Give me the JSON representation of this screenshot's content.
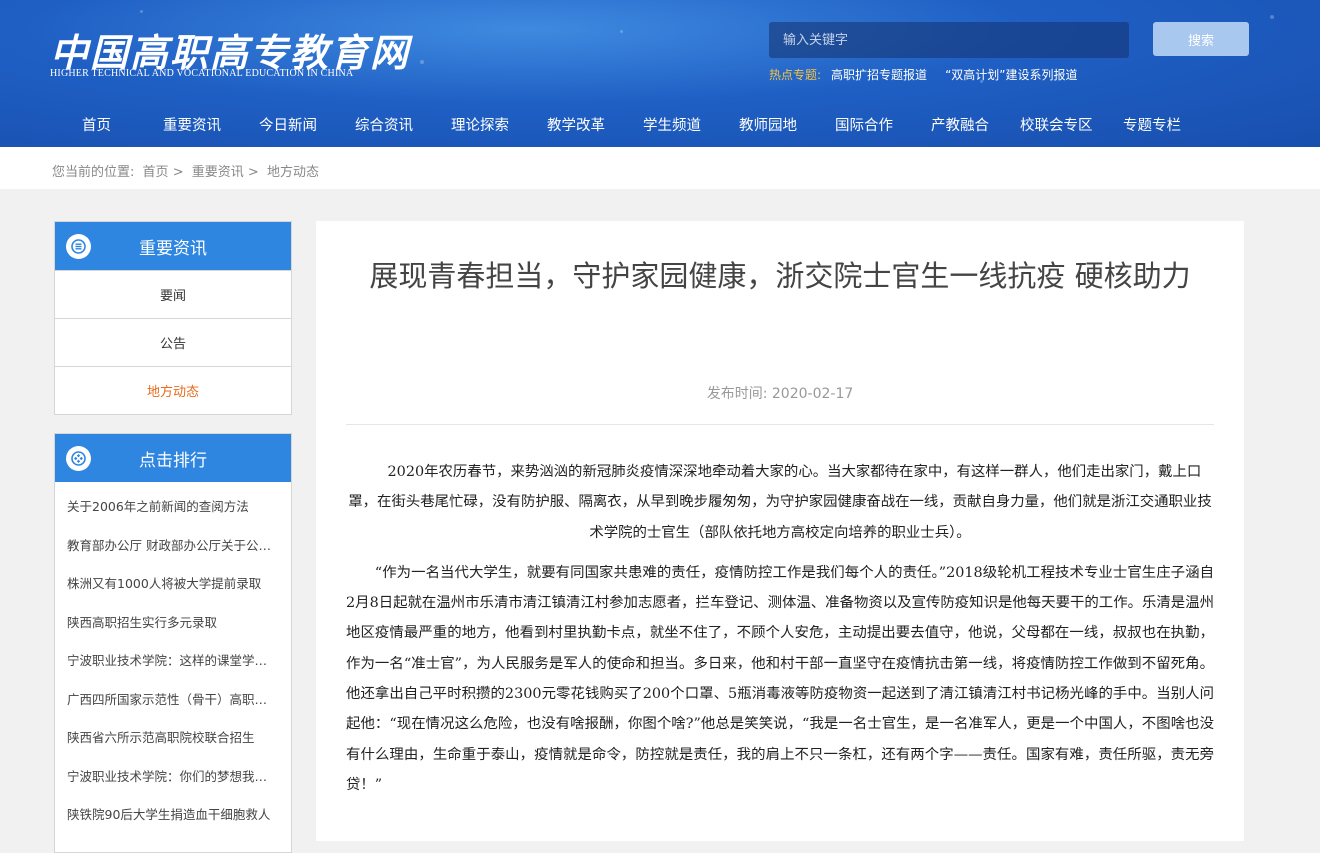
{
  "header": {
    "logo_text": "中国高职高专教育网",
    "logo_subtitle": "HIGHER TECHNICAL AND VOCATIONAL EDUCATION IN CHINA",
    "search_placeholder": "输入关键字",
    "search_button": "搜索",
    "hot_label": "热点专题:",
    "hot_links": [
      "高职扩招专题报道",
      "“双高计划”建设系列报道"
    ]
  },
  "nav": [
    "首页",
    "重要资讯",
    "今日新闻",
    "综合资讯",
    "理论探索",
    "教学改革",
    "学生频道",
    "教师园地",
    "国际合作",
    "产教融合",
    "校联会专区",
    "专题专栏"
  ],
  "breadcrumb": {
    "label": "您当前的位置:",
    "items": [
      "首页",
      "重要资讯",
      "地方动态"
    ],
    "sep": ">"
  },
  "sidebar": {
    "news_title": "重要资讯",
    "menu": [
      "要闻",
      "公告",
      "地方动态"
    ],
    "rank_title": "点击排行",
    "rank_items": [
      "关于2006年之前新闻的查阅方法",
      "教育部办公厅 财政部办公厅关于公布第二批",
      "株洲又有1000人将被大学提前录取",
      "陕西高职招生实行多元录取",
      "宁波职业技术学院：这样的课堂学生喜欢",
      "广西四所国家示范性（骨干）高职院校",
      "陕西省六所示范高职院校联合招生",
      "宁波职业技术学院：你们的梦想我来守护",
      "陕铁院90后大学生捐造血干细胞救人"
    ]
  },
  "article": {
    "title": "展现青春担当，守护家园健康，浙交院士官生一线抗疫 硬核助力",
    "date_label": "发布时间:",
    "date": "2020-02-17",
    "paragraphs": [
      "2020年农历春节，来势汹汹的新冠肺炎疫情深深地牵动着大家的心。当大家都待在家中，有这样一群人，他们走出家门，戴上口罩，在街头巷尾忙碌，没有防护服、隔离衣，从早到晚步履匆匆，为守护家园健康奋战在一线，贡献自身力量，他们就是浙江交通职业技术学院的士官生（部队依托地方高校定向培养的职业士兵）。",
      "“作为一名当代大学生，就要有同国家共患难的责任，疫情防控工作是我们每个人的责任。”2018级轮机工程技术专业士官生庄子涵自2月8日起就在温州市乐清市清江镇清江村参加志愿者，拦车登记、测体温、准备物资以及宣传防疫知识是他每天要干的工作。乐清是温州地区疫情最严重的地方，他看到村里执勤卡点，就坐不住了，不顾个人安危，主动提出要去值守，他说，父母都在一线，叔叔也在执勤，作为一名“准士官”，为人民服务是军人的使命和担当。多日来，他和村干部一直坚守在疫情抗击第一线，将疫情防控工作做到不留死角。他还拿出自己平时积攒的2300元零花钱购买了200个口罩、5瓶消毒液等防疫物资一起送到了清江镇清江村书记杨光峰的手中。当别人问起他：“现在情况这么危险，也没有啥报酬，你图个啥?”他总是笑笑说，“我是一名士官生，是一名准军人，更是一个中国人，不图啥也没有什么理由，生命重于泰山，疫情就是命令，防控就是责任，我的肩上不只一条杠，还有两个字——责任。国家有难，责任所驱，责无旁贷！”"
    ]
  }
}
